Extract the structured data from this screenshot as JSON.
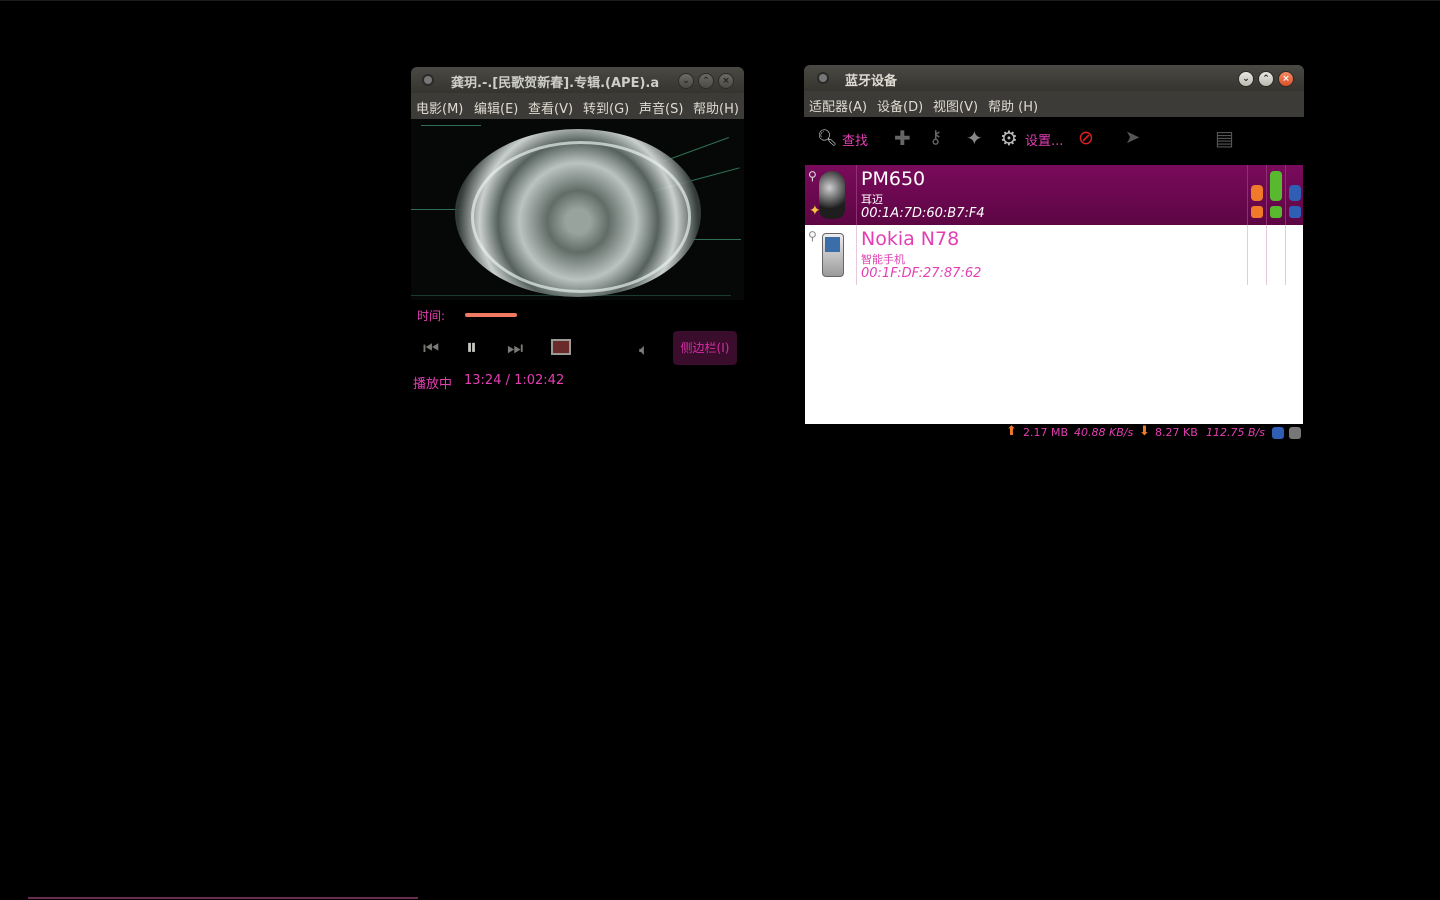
{
  "player": {
    "title": "龚玥.-.[民歌贺新春].专辑.(APE).a",
    "menu": [
      "电影(M)",
      "编辑(E)",
      "查看(V)",
      "转到(G)",
      "声音(S)",
      "帮助(H)"
    ],
    "time_label": "时间:",
    "progress": 0.216,
    "sidebar_button": "侧边栏(I)",
    "state": "播放中",
    "time": "13:24 / 1:02:42"
  },
  "bluetooth": {
    "title": "蓝牙设备",
    "menu": [
      "适配器(A)",
      "设备(D)",
      "视图(V)",
      "帮助 (H)"
    ],
    "toolbar": {
      "search": "查找",
      "settings": "设置..."
    },
    "devices": [
      {
        "name": "PM650",
        "type": "耳迈",
        "address": "00:1A:7D:60:B7:F4",
        "selected": true
      },
      {
        "name": "Nokia N78",
        "type": "智能手机",
        "address": "00:1F:DF:27:87:62",
        "selected": false
      }
    ],
    "status": {
      "up_total": "2.17 MB",
      "up_rate": "40.88 KB/s",
      "down_total": "8.27 KB",
      "down_rate": "112.75 B/s"
    }
  },
  "colors": {
    "accent": "#e33fb3",
    "selected_row": "#6a0850",
    "titlebar": "#3c3b37"
  }
}
